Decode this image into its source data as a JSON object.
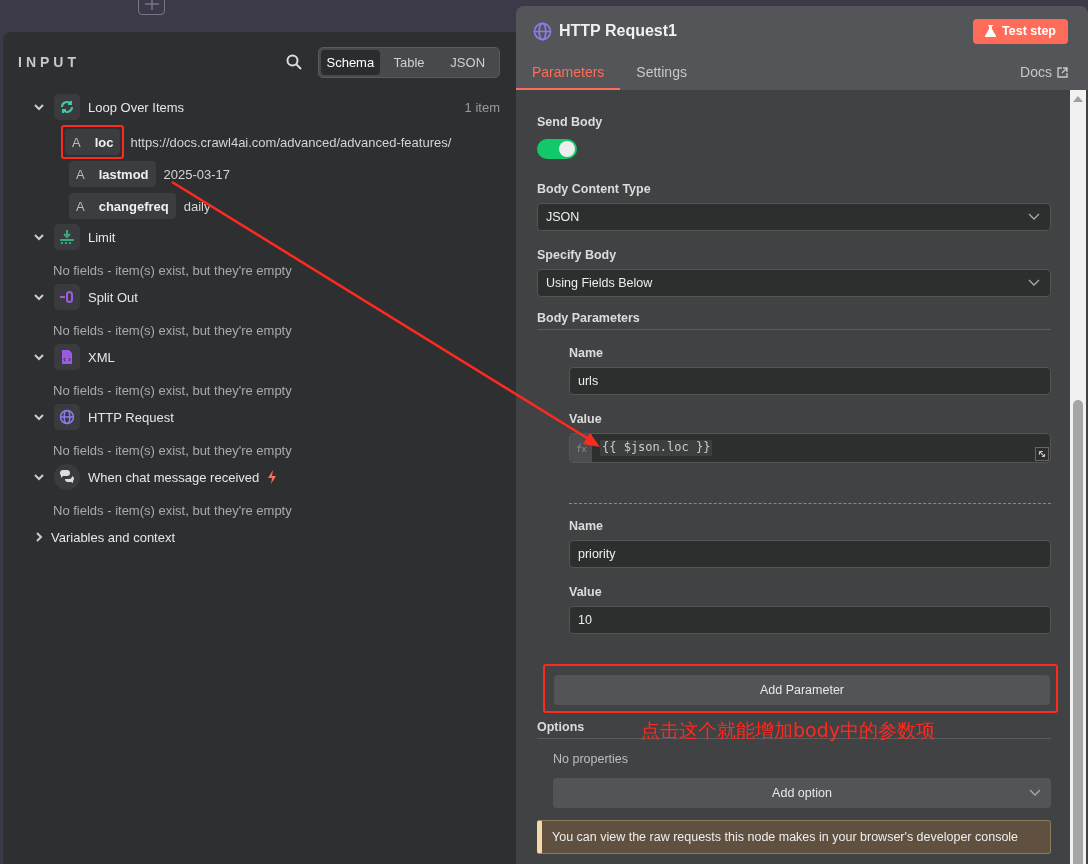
{
  "input_panel": {
    "title": "INPUT",
    "view_tabs": [
      {
        "label": "Schema",
        "selected": true
      },
      {
        "label": "Table",
        "selected": false
      },
      {
        "label": "JSON",
        "selected": false
      }
    ],
    "nodes": [
      {
        "kind": "loop",
        "name": "Loop Over Items",
        "expanded": true,
        "count": "1 item",
        "fields": [
          {
            "type_label": "A",
            "name": "loc",
            "value": "https://docs.crawl4ai.com/advanced/advanced-features/",
            "highlighted": true
          },
          {
            "type_label": "A",
            "name": "lastmod",
            "value": "2025-03-17",
            "highlighted": false
          },
          {
            "type_label": "A",
            "name": "changefreq",
            "value": "daily",
            "highlighted": false
          }
        ]
      },
      {
        "kind": "limit",
        "name": "Limit",
        "expanded": true,
        "message": "No fields - item(s) exist, but they're empty"
      },
      {
        "kind": "split",
        "name": "Split Out",
        "expanded": true,
        "message": "No fields - item(s) exist, but they're empty"
      },
      {
        "kind": "xml",
        "name": "XML",
        "expanded": true,
        "message": "No fields - item(s) exist, but they're empty"
      },
      {
        "kind": "http",
        "name": "HTTP Request",
        "expanded": true,
        "message": "No fields - item(s) exist, but they're empty"
      },
      {
        "kind": "chat",
        "name": "When chat message received",
        "expanded": true,
        "trigger": true,
        "message": "No fields - item(s) exist, but they're empty"
      }
    ],
    "variables": {
      "label": "Variables and context",
      "expanded": false
    }
  },
  "node_panel": {
    "title": "HTTP Request1",
    "test_button": "Test step",
    "tabs": [
      {
        "label": "Parameters",
        "selected": true
      },
      {
        "label": "Settings",
        "selected": false
      }
    ],
    "docs_link": "Docs",
    "send_body": {
      "label": "Send Body",
      "on": true
    },
    "body_content_type": {
      "label": "Body Content Type",
      "value": "JSON"
    },
    "specify_body": {
      "label": "Specify Body",
      "value": "Using Fields Below"
    },
    "body_parameters": {
      "label": "Body Parameters",
      "items": [
        {
          "name_label": "Name",
          "name": "urls",
          "value_label": "Value",
          "value": "{{ $json.loc }}",
          "expression": true
        },
        {
          "name_label": "Name",
          "name": "priority",
          "value_label": "Value",
          "value": "10",
          "expression": false
        }
      ]
    },
    "add_parameter": {
      "label": "Add Parameter",
      "highlighted": true
    },
    "options": {
      "label": "Options",
      "empty_text": "No properties",
      "add_button": "Add option"
    },
    "notice": "You can view the raw requests this node makes in your browser's developer console"
  },
  "annotation_note": "点击这个就能增加body中的参数项"
}
